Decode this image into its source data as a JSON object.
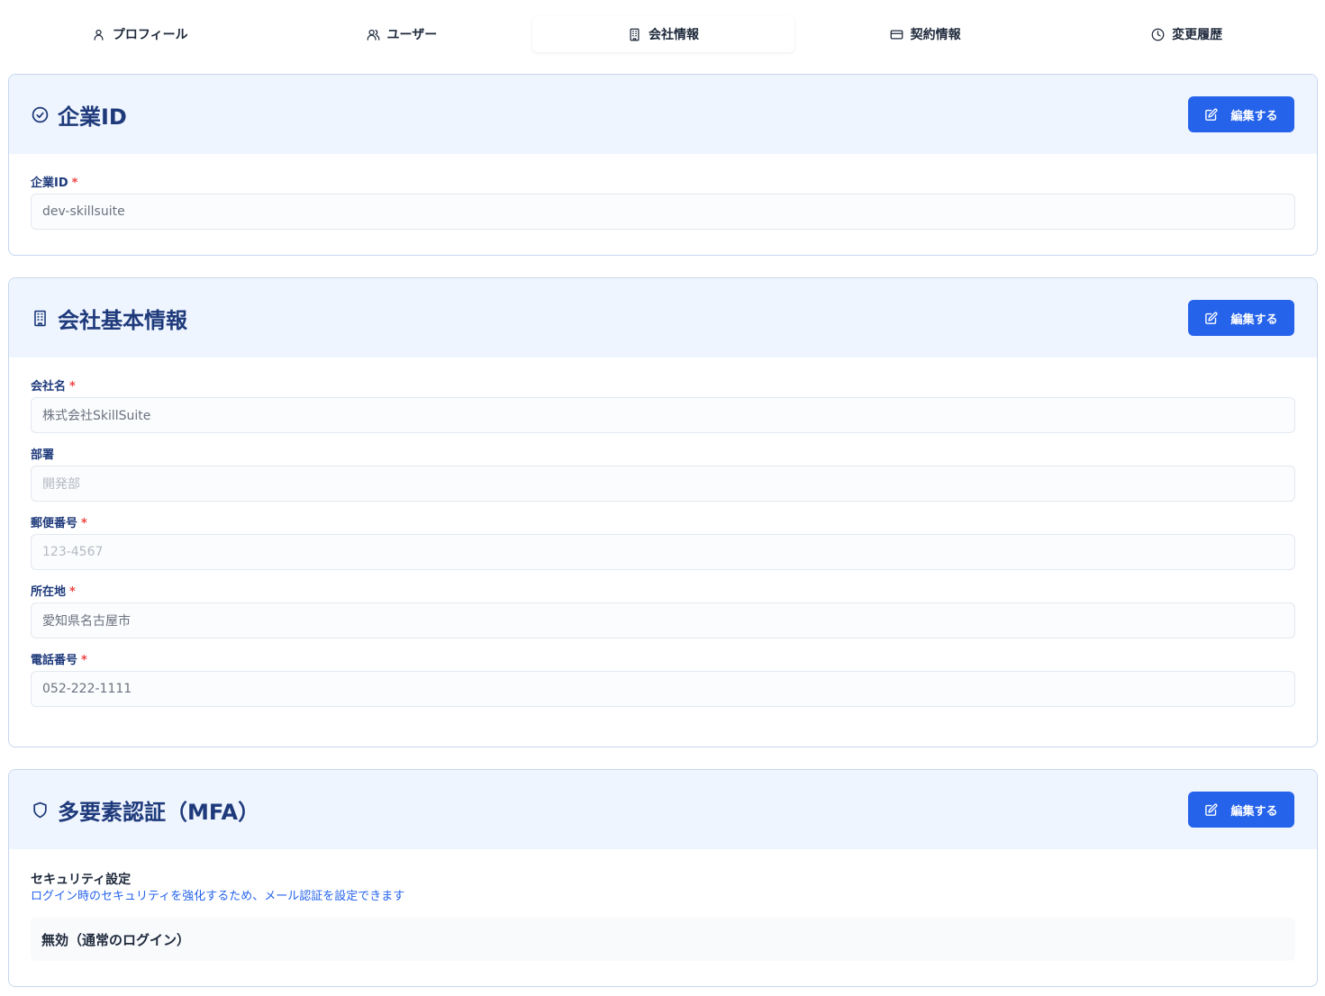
{
  "tabs": [
    {
      "label": "プロフィール",
      "icon": "user-icon"
    },
    {
      "label": "ユーザー",
      "icon": "users-icon"
    },
    {
      "label": "会社情報",
      "icon": "building-icon",
      "active": true
    },
    {
      "label": "契約情報",
      "icon": "credit-card-icon"
    },
    {
      "label": "変更履歴",
      "icon": "clock-icon"
    }
  ],
  "company_id_card": {
    "title": "企業ID",
    "edit_label": "編集する",
    "field": {
      "label": "企業ID",
      "required_mark": "*",
      "value": "dev-skillsuite"
    }
  },
  "company_info_card": {
    "title": "会社基本情報",
    "edit_label": "編集する",
    "fields": [
      {
        "label": "会社名",
        "required_mark": "*",
        "value": "株式会社SkillSuite"
      },
      {
        "label": "部署",
        "placeholder": "開発部"
      },
      {
        "label": "郵便番号",
        "required_mark": "*",
        "placeholder": "123-4567"
      },
      {
        "label": "所在地",
        "required_mark": "*",
        "value": "愛知県名古屋市"
      },
      {
        "label": "電話番号",
        "required_mark": "*",
        "value": "052-222-1111"
      }
    ]
  },
  "mfa_card": {
    "title": "多要素認証（MFA）",
    "edit_label": "編集する",
    "section_title": "セキュリティ設定",
    "section_desc": "ログイン時のセキュリティを強化するため、メール認証を設定できます",
    "status": "無効（通常のログイン）"
  },
  "colors": {
    "accent": "#2563eb",
    "header_bg": "#eff5ff",
    "title": "#1e3a7b",
    "required": "#ef4444"
  }
}
